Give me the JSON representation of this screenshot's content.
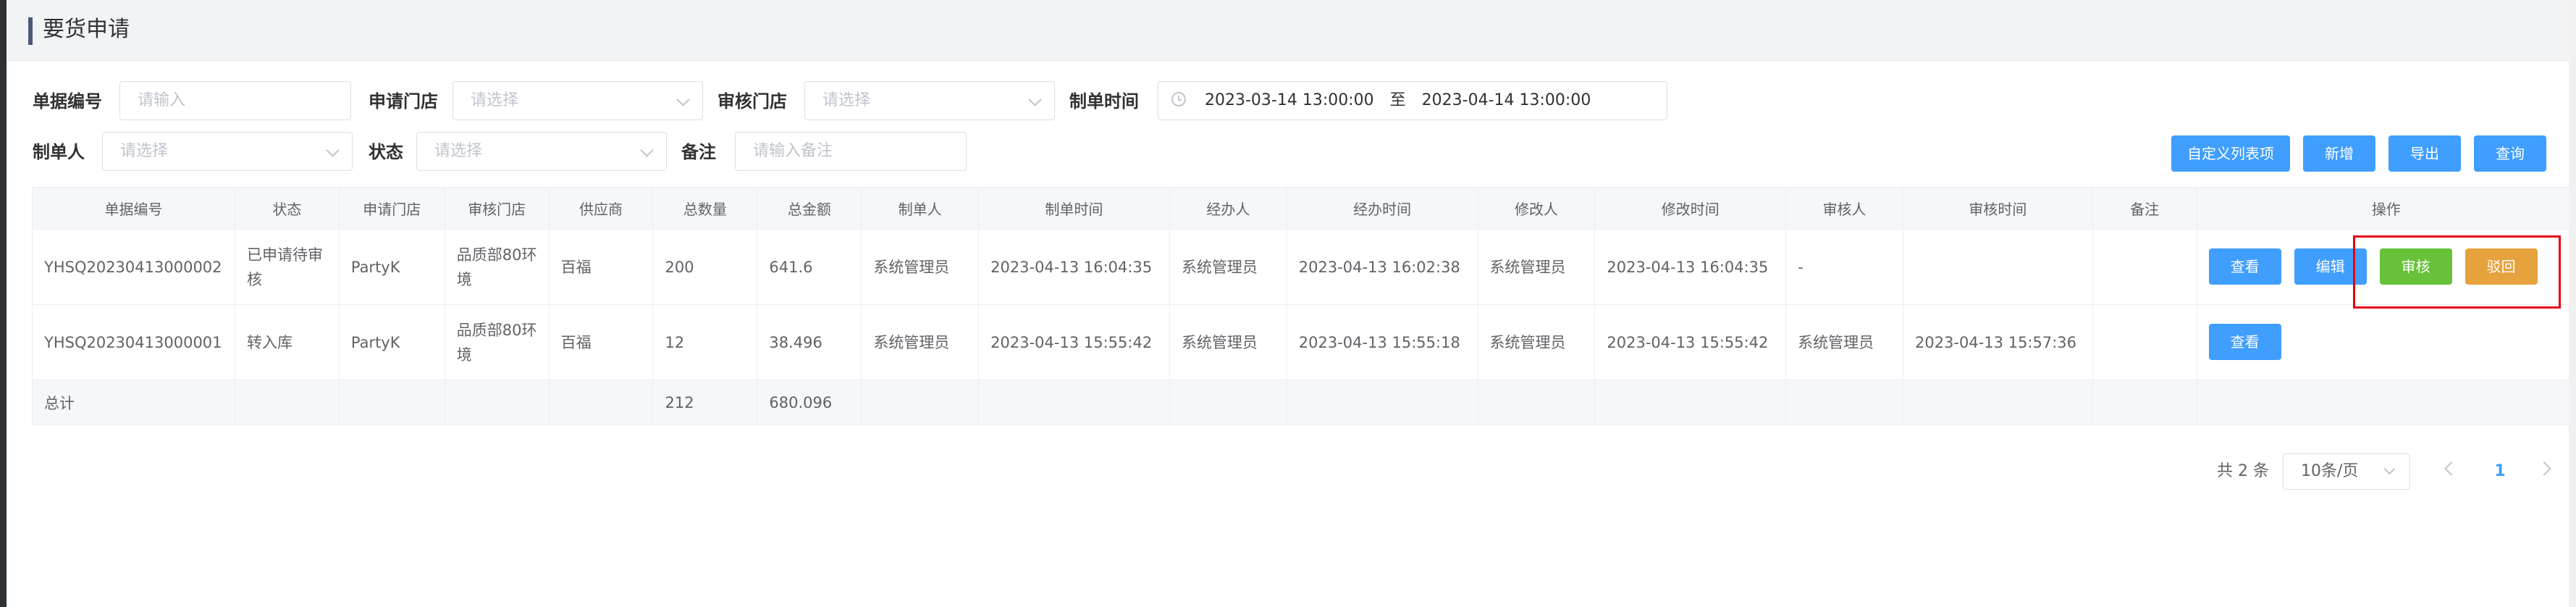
{
  "page": {
    "title": "要货申请"
  },
  "filters": {
    "order_no": {
      "label": "单据编号",
      "placeholder": "请输入"
    },
    "apply_store": {
      "label": "申请门店",
      "placeholder": "请选择"
    },
    "review_store": {
      "label": "审核门店",
      "placeholder": "请选择"
    },
    "create_time": {
      "label": "制单时间",
      "start": "2023-03-14 13:00:00",
      "separator": "至",
      "end": "2023-04-14 13:00:00"
    },
    "creator": {
      "label": "制单人",
      "placeholder": "请选择"
    },
    "status": {
      "label": "状态",
      "placeholder": "请选择"
    },
    "remark": {
      "label": "备注",
      "placeholder": "请输入备注"
    }
  },
  "toolbar": {
    "custom_columns": "自定义列表项",
    "add": "新增",
    "export": "导出",
    "query": "查询"
  },
  "table": {
    "columns": [
      "单据编号",
      "状态",
      "申请门店",
      "审核门店",
      "供应商",
      "总数量",
      "总金额",
      "制单人",
      "制单时间",
      "经办人",
      "经办时间",
      "修改人",
      "修改时间",
      "审核人",
      "审核时间",
      "备注",
      "操作"
    ],
    "rows": [
      {
        "order_no": "YHSQ20230413000002",
        "status": "已申请待审核",
        "apply_store": "PartyK",
        "review_store": "品质部80环境",
        "supplier": "百福",
        "total_qty": "200",
        "total_amount": "641.6",
        "creator": "系统管理员",
        "create_time": "2023-04-13 16:04:35",
        "handler": "系统管理员",
        "handle_time": "2023-04-13 16:02:38",
        "modifier": "系统管理员",
        "modify_time": "2023-04-13 16:04:35",
        "reviewer": "-",
        "review_time": "",
        "remark": "",
        "actions": {
          "view": "查看",
          "edit": "编辑",
          "approve": "审核",
          "reject": "驳回"
        }
      },
      {
        "order_no": "YHSQ20230413000001",
        "status": "转入库",
        "apply_store": "PartyK",
        "review_store": "品质部80环境",
        "supplier": "百福",
        "total_qty": "12",
        "total_amount": "38.496",
        "creator": "系统管理员",
        "create_time": "2023-04-13 15:55:42",
        "handler": "系统管理员",
        "handle_time": "2023-04-13 15:55:18",
        "modifier": "系统管理员",
        "modify_time": "2023-04-13 15:55:42",
        "reviewer": "系统管理员",
        "review_time": "2023-04-13 15:57:36",
        "remark": "",
        "actions": {
          "view": "查看"
        }
      }
    ],
    "total": {
      "label": "总计",
      "total_qty": "212",
      "total_amount": "680.096"
    }
  },
  "pagination": {
    "total_text": "共 2 条",
    "page_size": "10条/页",
    "current_page": "1"
  },
  "colors": {
    "primary": "#409eff",
    "success": "#67c23a",
    "warning": "#e6a23c",
    "highlight": "#e60012"
  }
}
